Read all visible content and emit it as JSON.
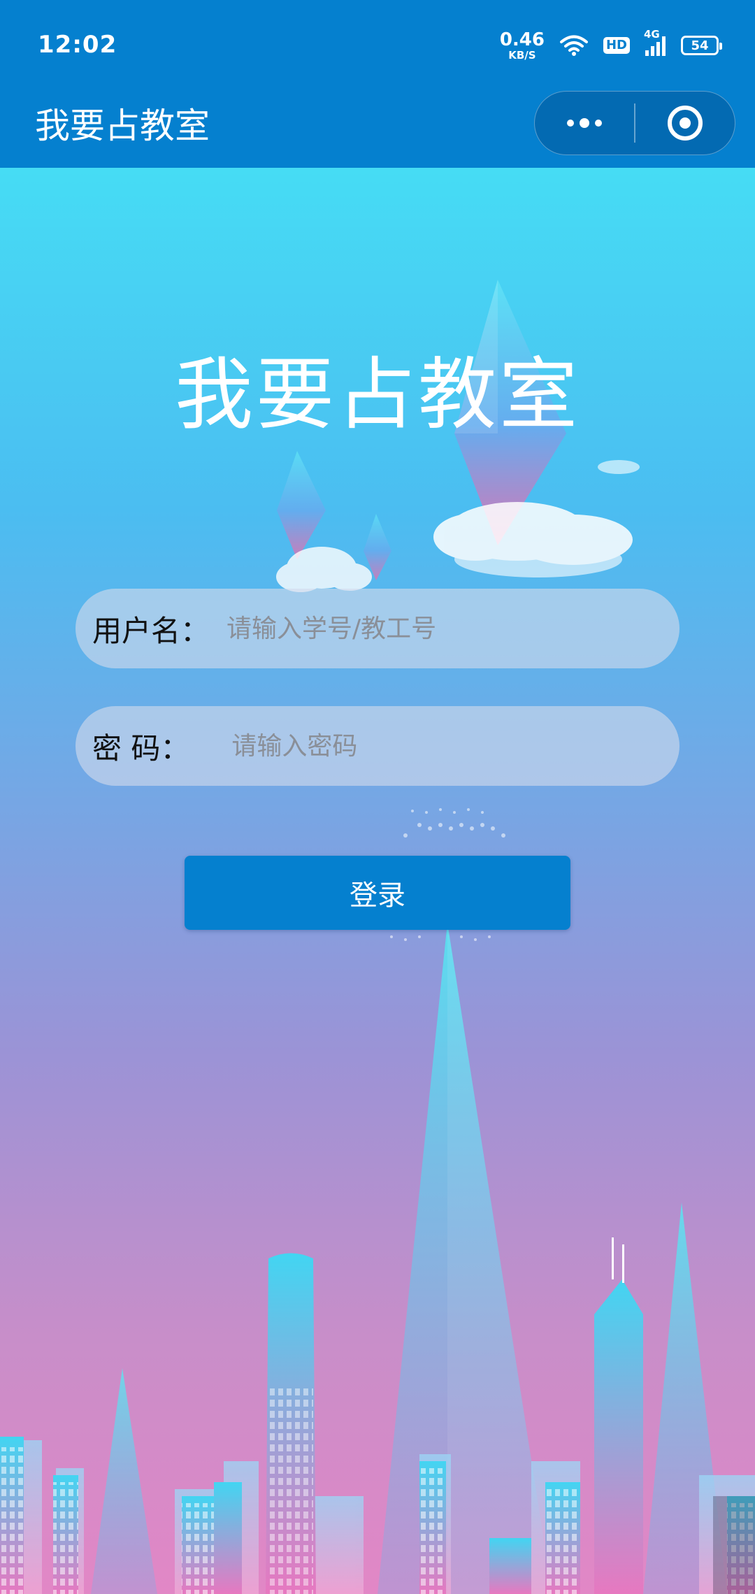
{
  "status_bar": {
    "time": "12:02",
    "net_speed_value": "0.46",
    "net_speed_unit": "KB/S",
    "hd_badge": "HD",
    "network_type": "4G",
    "battery_level": "54"
  },
  "nav_bar": {
    "title": "我要占教室",
    "more_icon": "more-dots-icon",
    "close_icon": "target-circle-icon"
  },
  "login": {
    "heading": "我要占教室",
    "username_label": "用户名：",
    "username_placeholder": "请输入学号/教工号",
    "password_label": "密 码：",
    "password_placeholder": "请输入密码",
    "submit_label": "登录"
  },
  "colors": {
    "primary": "#0580cf",
    "gradient_top": "#46dcf4",
    "gradient_bottom": "#e287c6"
  }
}
